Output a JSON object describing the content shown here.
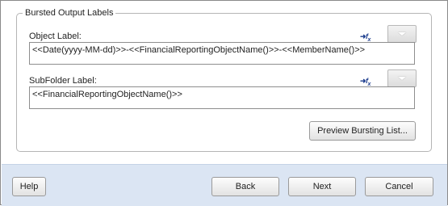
{
  "group": {
    "title": "Bursted Output Labels"
  },
  "object_label": {
    "label": "Object Label:",
    "fx_icon": "function-insert-icon",
    "fx_glyph": "f",
    "fx_sub": "x",
    "value": "<<Date(yyyy-MM-dd)>>-<<FinancialReportingObjectName()>>-<<MemberName()>>"
  },
  "subfolder_label": {
    "label": "SubFolder Label:",
    "fx_icon": "function-insert-icon",
    "fx_glyph": "f",
    "fx_sub": "x",
    "value": "<<FinancialReportingObjectName()>>"
  },
  "preview_button": {
    "label": "Preview Bursting List..."
  },
  "footer": {
    "help_label": "Help",
    "back_label": "Back",
    "next_label": "Next",
    "cancel_label": "Cancel"
  }
}
